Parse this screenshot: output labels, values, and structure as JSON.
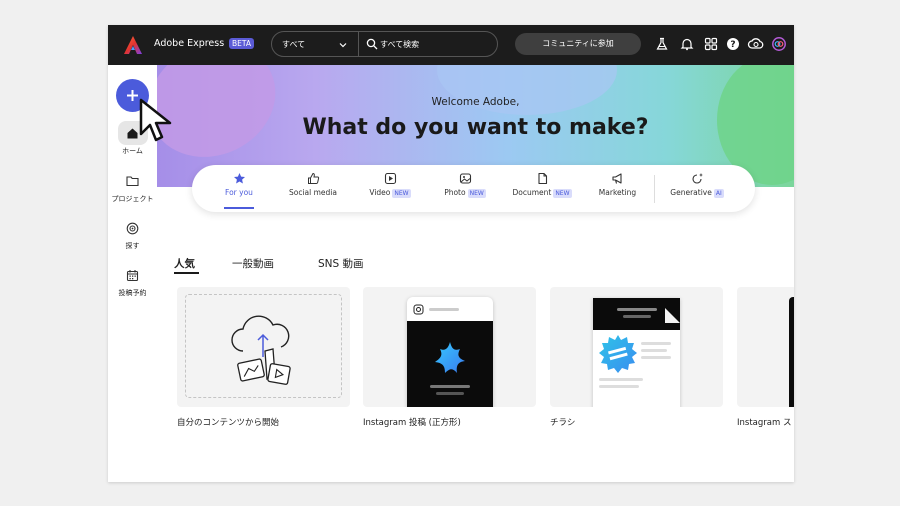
{
  "app": {
    "name": "Adobe Express",
    "badge": "BETA"
  },
  "search": {
    "scope": "すべて",
    "placeholder": "すべて検索"
  },
  "topbar": {
    "join_label": "コミュニティに参加",
    "icons": [
      "flask-icon",
      "bell-icon",
      "apps-grid-icon",
      "help-icon",
      "creative-cloud-icon",
      "account-avatar-icon"
    ]
  },
  "rail": {
    "create_icon": "plus-icon",
    "items": [
      {
        "label": "ホーム",
        "icon": "home-icon",
        "active": true
      },
      {
        "label": "プロジェクト",
        "icon": "folder-icon",
        "active": false
      },
      {
        "label": "探す",
        "icon": "discover-icon",
        "active": false
      },
      {
        "label": "投稿予約",
        "icon": "calendar-icon",
        "active": false
      }
    ]
  },
  "hero": {
    "welcome": "Welcome Adobe,",
    "headline": "What do you want to make?"
  },
  "categories": [
    {
      "label": "For you",
      "icon": "star-icon",
      "badge": "",
      "active": true
    },
    {
      "label": "Social media",
      "icon": "thumbs-up-icon",
      "badge": ""
    },
    {
      "label": "Video",
      "icon": "play-icon",
      "badge": "NEW"
    },
    {
      "label": "Photo",
      "icon": "image-icon",
      "badge": "NEW"
    },
    {
      "label": "Document",
      "icon": "document-icon",
      "badge": "NEW"
    },
    {
      "label": "Marketing",
      "icon": "megaphone-icon",
      "badge": ""
    },
    {
      "label": "Generative",
      "icon": "sparkle-icon",
      "badge": "AI"
    }
  ],
  "content_tabs": [
    {
      "label": "人気",
      "active": true
    },
    {
      "label": "一般動画",
      "active": false
    },
    {
      "label": "SNS 動画",
      "active": false
    }
  ],
  "cards": [
    {
      "label": "自分のコンテンツから開始"
    },
    {
      "label": "Instagram 投稿 (正方形)"
    },
    {
      "label": "チラシ"
    },
    {
      "label": "Instagram ス"
    }
  ],
  "colors": {
    "accent": "#4b5bdb",
    "topbar": "#1c1c1c"
  }
}
